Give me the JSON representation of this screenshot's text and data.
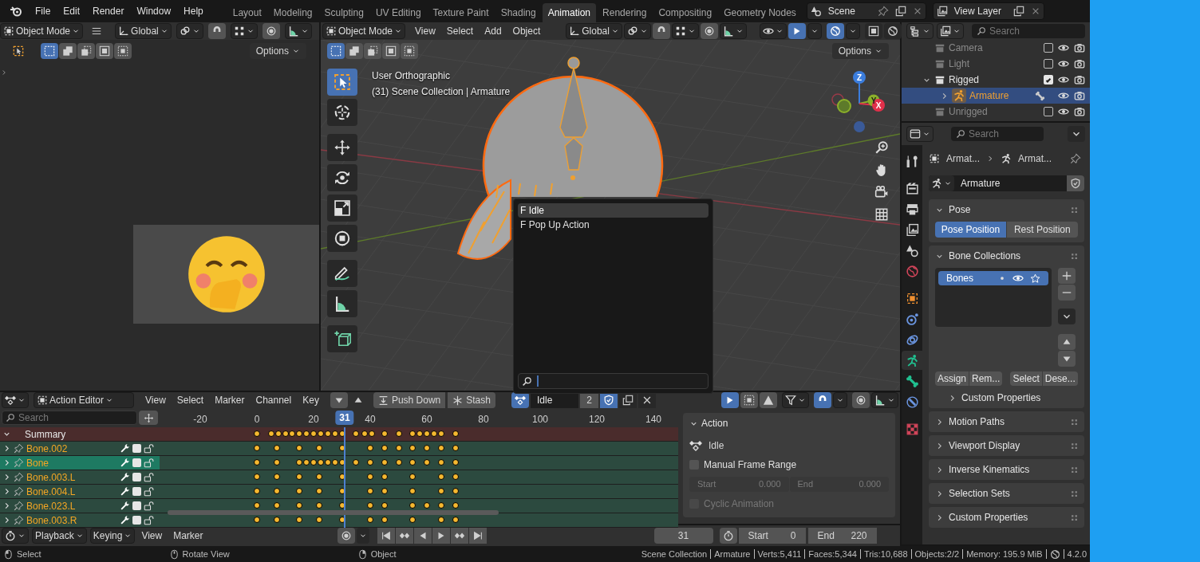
{
  "top_menu": [
    "File",
    "Edit",
    "Render",
    "Window",
    "Help"
  ],
  "workspaces": [
    {
      "label": "Layout",
      "selected": false
    },
    {
      "label": "Modeling",
      "selected": false
    },
    {
      "label": "Sculpting",
      "selected": false
    },
    {
      "label": "UV Editing",
      "selected": false
    },
    {
      "label": "Texture Paint",
      "selected": false
    },
    {
      "label": "Shading",
      "selected": false
    },
    {
      "label": "Animation",
      "selected": true
    },
    {
      "label": "Rendering",
      "selected": false
    },
    {
      "label": "Compositing",
      "selected": false
    },
    {
      "label": "Geometry Nodes",
      "selected": false
    }
  ],
  "scene": {
    "name": "Scene"
  },
  "view_layer": {
    "name": "View Layer"
  },
  "image_editor": {
    "mode": "Object Mode",
    "orientation": "Global",
    "options": "Options"
  },
  "viewport": {
    "mode": "Object Mode",
    "menus": [
      "View",
      "Select",
      "Add",
      "Object"
    ],
    "orientation": "Global",
    "options": "Options",
    "info": [
      "User Orthographic",
      "(31) Scene Collection | Armature"
    ],
    "tools": [
      {
        "kind": "select",
        "selected": true
      },
      {
        "kind": "cursor",
        "selected": false
      },
      {
        "kind": "move",
        "selected": false
      },
      {
        "kind": "rotate",
        "selected": false
      },
      {
        "kind": "scale",
        "selected": false
      },
      {
        "kind": "transform",
        "selected": false
      },
      {
        "kind": "annotate",
        "selected": false
      },
      {
        "kind": "measure",
        "selected": false
      },
      {
        "kind": "add_cube",
        "selected": false
      }
    ],
    "gizmo_axes": [
      "Z",
      "Y",
      "X"
    ]
  },
  "action_menu": {
    "items": [
      {
        "label": "F Idle",
        "selected": true
      },
      {
        "label": "F Pop Up Action",
        "selected": false
      }
    ]
  },
  "outliner": {
    "search": {
      "placeholder": "Search"
    },
    "items": [
      {
        "kind": "collection",
        "label": "Camera",
        "checked": false,
        "selected": false
      },
      {
        "kind": "collection",
        "label": "Light",
        "checked": false,
        "selected": false
      },
      {
        "kind": "collection",
        "label": "Rigged",
        "checked": true,
        "selected": false,
        "expanded": true,
        "children": [
          {
            "kind": "object",
            "label": "Armature",
            "selected": true,
            "expanded": false
          }
        ]
      },
      {
        "kind": "collection",
        "label": "Unrigged",
        "checked": false,
        "selected": false
      }
    ]
  },
  "properties": {
    "search": {
      "placeholder": "Search"
    },
    "tabs": [
      {
        "kind": "tool",
        "selected": false
      },
      {
        "kind": "render",
        "selected": false
      },
      {
        "kind": "output",
        "selected": false
      },
      {
        "kind": "view_layer",
        "selected": false
      },
      {
        "kind": "scene",
        "selected": false
      },
      {
        "kind": "world",
        "selected": false
      },
      {
        "kind": "object",
        "selected": false
      },
      {
        "kind": "physics",
        "selected": false
      },
      {
        "kind": "constraints",
        "selected": false
      },
      {
        "kind": "armature",
        "selected": true
      },
      {
        "kind": "bone",
        "selected": false
      },
      {
        "kind": "bone_constraints",
        "selected": false
      },
      {
        "kind": "texture",
        "selected": false
      }
    ],
    "breadcrumb": [
      "Armat...",
      "Armat..."
    ],
    "data_block": "Armature",
    "panels": [
      {
        "kind": "pose",
        "title": "Pose",
        "expanded": true,
        "buttons": [
          {
            "label": "Pose Position",
            "selected": true
          },
          {
            "label": "Rest Position",
            "selected": false
          }
        ]
      },
      {
        "kind": "bone_collections",
        "title": "Bone Collections",
        "expanded": true,
        "collections": [
          {
            "name": "Bones",
            "selected": true
          }
        ],
        "buttons": [
          "Assign",
          "Rem...",
          "Select",
          "Dese..."
        ],
        "subpanel": {
          "title": "Custom Properties",
          "expanded": false
        }
      },
      {
        "kind": "plain",
        "title": "Motion Paths",
        "expanded": false
      },
      {
        "kind": "plain",
        "title": "Viewport Display",
        "expanded": false
      },
      {
        "kind": "plain",
        "title": "Inverse Kinematics",
        "expanded": false
      },
      {
        "kind": "plain",
        "title": "Selection Sets",
        "expanded": false
      },
      {
        "kind": "plain",
        "title": "Custom Properties",
        "expanded": false
      }
    ]
  },
  "dope_sheet": {
    "mode": "Action Editor",
    "menus": [
      "View",
      "Select",
      "Marker",
      "Channel",
      "Key"
    ],
    "push_down": "Push Down",
    "stash": "Stash",
    "action": "Idle",
    "users": "2",
    "search": {
      "placeholder": "Search"
    },
    "frame_labels": [
      "-20",
      "0",
      "20",
      "40",
      "60",
      "80",
      "100",
      "120",
      "140"
    ],
    "current_frame": "31",
    "channels": [
      {
        "kind": "summary",
        "name": "Summary",
        "expanded": true
      },
      {
        "kind": "group",
        "name": "Bone.002",
        "expanded": false,
        "selected": false
      },
      {
        "kind": "group",
        "name": "Bone",
        "expanded": false,
        "selected": true
      },
      {
        "kind": "group",
        "name": "Bone.003.L",
        "expanded": false,
        "selected": false
      },
      {
        "kind": "group",
        "name": "Bone.004.L",
        "expanded": false,
        "selected": false
      },
      {
        "kind": "group",
        "name": "Bone.023.L",
        "expanded": false,
        "selected": false
      },
      {
        "kind": "group",
        "name": "Bone.003.R",
        "expanded": false,
        "selected": false
      }
    ]
  },
  "action_panel": {
    "title": "Action",
    "action": "Idle",
    "manual_frame_range": {
      "label": "Manual Frame Range",
      "checked": false
    },
    "start": {
      "label": "Start",
      "value": "0.000",
      "disabled": true
    },
    "end": {
      "label": "End",
      "value": "0.000",
      "disabled": true
    },
    "cyclic": {
      "label": "Cyclic Animation",
      "checked": false,
      "disabled": true
    }
  },
  "timeline": {
    "menus": [
      "Playback",
      "Keying",
      "View",
      "Marker"
    ],
    "current_frame": "31",
    "start": {
      "label": "Start",
      "value": "0"
    },
    "end": {
      "label": "End",
      "value": "220"
    }
  },
  "status_bar": {
    "hints": [
      {
        "kind": "left",
        "label": "Select"
      },
      {
        "kind": "middle",
        "label": "Rotate View"
      },
      {
        "kind": "right",
        "label": "Object"
      }
    ],
    "stats": [
      "Scene Collection",
      "Armature",
      "Verts:5,411",
      "Faces:5,344",
      "Tris:10,688",
      "Objects:2/2",
      "Memory: 195.9 MiB"
    ],
    "version": "4.2.0"
  }
}
